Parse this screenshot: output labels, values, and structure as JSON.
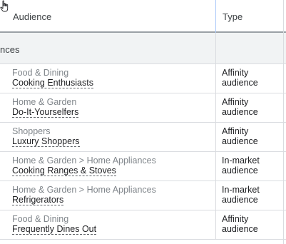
{
  "header": {
    "audience_label": "Audience",
    "type_label": "Type"
  },
  "group": {
    "label": "nces"
  },
  "rows": [
    {
      "category": "Food & Dining",
      "name": "Cooking Enthusiasts",
      "type": "Affinity audience"
    },
    {
      "category": "Home & Garden",
      "name": "Do-It-Yourselfers",
      "type": "Affinity audience"
    },
    {
      "category": "Shoppers",
      "name": "Luxury Shoppers",
      "type": "Affinity audience"
    },
    {
      "category": "Home & Garden > Home Appliances",
      "name": "Cooking Ranges & Stoves",
      "type": "In-market audience"
    },
    {
      "category": "Home & Garden > Home Appliances",
      "name": "Refrigerators",
      "type": "In-market audience"
    },
    {
      "category": "Food & Dining",
      "name": "Frequently Dines Out",
      "type": "Affinity audience"
    }
  ],
  "colors": {
    "header_divider_accent": "#aecbfa",
    "group_background": "#f1f3f4",
    "category_text": "#80868b"
  },
  "icons": {
    "cursor": "hand-pointer-icon"
  }
}
